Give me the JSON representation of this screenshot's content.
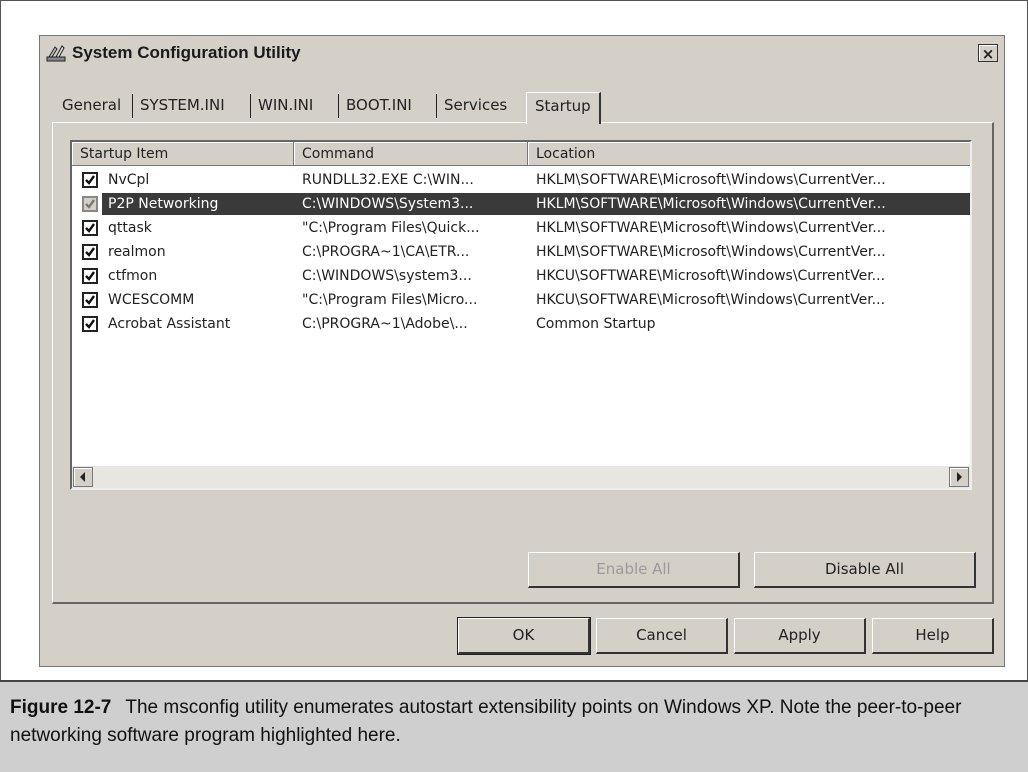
{
  "window": {
    "title": "System Configuration Utility",
    "close_label": "×"
  },
  "tabs": [
    {
      "label": "General"
    },
    {
      "label": "SYSTEM.INI"
    },
    {
      "label": "WIN.INI"
    },
    {
      "label": "BOOT.INI"
    },
    {
      "label": "Services"
    },
    {
      "label": "Startup",
      "active": true
    }
  ],
  "columns": [
    "Startup Item",
    "Command",
    "Location"
  ],
  "rows": [
    {
      "item": "NvCpl",
      "command": "RUNDLL32.EXE C:\\WIN...",
      "location": "HKLM\\SOFTWARE\\Microsoft\\Windows\\CurrentVer...",
      "checked": true
    },
    {
      "item": "P2P Networking",
      "command": "C:\\WINDOWS\\System3...",
      "location": "HKLM\\SOFTWARE\\Microsoft\\Windows\\CurrentVer...",
      "checked": true,
      "selected": true
    },
    {
      "item": "qttask",
      "command": "\"C:\\Program Files\\Quick...",
      "location": "HKLM\\SOFTWARE\\Microsoft\\Windows\\CurrentVer...",
      "checked": true
    },
    {
      "item": "realmon",
      "command": "C:\\PROGRA~1\\CA\\ETR...",
      "location": "HKLM\\SOFTWARE\\Microsoft\\Windows\\CurrentVer...",
      "checked": true
    },
    {
      "item": "ctfmon",
      "command": "C:\\WINDOWS\\system3...",
      "location": "HKCU\\SOFTWARE\\Microsoft\\Windows\\CurrentVer...",
      "checked": true
    },
    {
      "item": "WCESCOMM",
      "command": "\"C:\\Program Files\\Micro...",
      "location": "HKCU\\SOFTWARE\\Microsoft\\Windows\\CurrentVer...",
      "checked": true
    },
    {
      "item": "Acrobat Assistant",
      "command": "C:\\PROGRA~1\\Adobe\\...",
      "location": "Common Startup",
      "checked": true
    }
  ],
  "panel_buttons": {
    "enable_all": "Enable All",
    "disable_all": "Disable All"
  },
  "dialog_buttons": {
    "ok": "OK",
    "cancel": "Cancel",
    "apply": "Apply",
    "help": "Help"
  },
  "caption": {
    "figure": "Figure 12-7",
    "text": "The msconfig utility enumerates autostart extensibility points on Windows XP. Note the peer-to-peer networking software program highlighted here."
  },
  "colors": {
    "dialog_bg": "#d4d0c8",
    "selection": "#3a3a3a",
    "caption_bg": "#cfcfcf"
  },
  "icons": {
    "app": "msconfig-app-icon",
    "close": "close-icon",
    "check": "check-icon"
  }
}
